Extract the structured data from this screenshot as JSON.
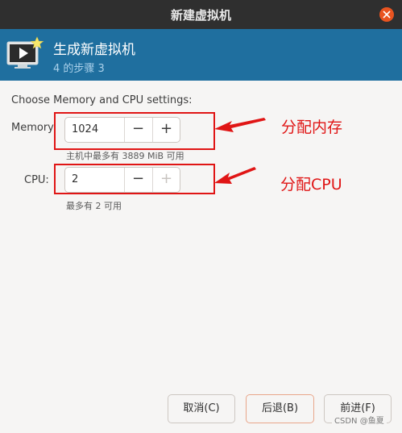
{
  "window": {
    "title": "新建虚拟机"
  },
  "header": {
    "title": "生成新虚拟机",
    "step": "4 的步骤 3",
    "icon": "vm-monitor-icon"
  },
  "section": {
    "label": "Choose Memory and CPU settings:"
  },
  "memory": {
    "label": "Memory:",
    "value": "1024",
    "minus": "−",
    "plus": "+",
    "hint": "主机中最多有 3889 MiB 可用"
  },
  "cpu": {
    "label": "CPU:",
    "value": "2",
    "minus": "−",
    "plus": "+",
    "hint": "最多有 2 可用"
  },
  "annotations": {
    "memory": "分配内存",
    "cpu": "分配CPU"
  },
  "buttons": {
    "cancel": "取消(C)",
    "back": "后退(B)",
    "forward": "前进(F)"
  },
  "watermark": "CSDN @鱼夏",
  "colors": {
    "header": "#1f6f9f",
    "annotation": "#e01515",
    "close": "#e95420"
  }
}
